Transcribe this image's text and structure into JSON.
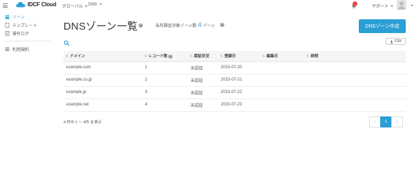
{
  "header": {
    "brand": "IDCF Cloud",
    "nav_global": "グローバル",
    "nav_dns": "DNS",
    "support": "サポート"
  },
  "sidebar": {
    "items": [
      {
        "label": "ゾーン",
        "icon": "zone-icon",
        "active": true
      },
      {
        "label": "テンプレート",
        "icon": "template-icon"
      },
      {
        "label": "操作ログ",
        "icon": "log-icon"
      },
      {
        "label": "利用規約",
        "icon": "terms-icon"
      }
    ]
  },
  "main": {
    "title": "DNSゾーン一覧",
    "zone_count_prefix": "当月課金対象ゾーン数",
    "zone_count_value": "4",
    "zone_count_suffix": "ゾーン",
    "create_button": "DNSゾーン作成",
    "csv_button": "CSV"
  },
  "table": {
    "headers": [
      "ドメイン",
      "レコード数",
      "認証状況",
      "登録日",
      "編集日",
      "説明"
    ],
    "rows": [
      {
        "domain": "example.com",
        "records": "1",
        "status": "未認証",
        "registered": "2015-07-20",
        "edited": "",
        "description": ""
      },
      {
        "domain": "example.co.jp",
        "records": "2",
        "status": "未認証",
        "registered": "2015-07-21",
        "edited": "",
        "description": ""
      },
      {
        "domain": "example.jp",
        "records": "3",
        "status": "未認証",
        "registered": "2015-07-22",
        "edited": "",
        "description": ""
      },
      {
        "domain": "example.net",
        "records": "4",
        "status": "未認証",
        "registered": "2015-07-23",
        "edited": "",
        "description": ""
      }
    ]
  },
  "pagination": {
    "info": "4 件中 1 ～ 4件 を表示",
    "prev": "‹",
    "current": "1",
    "next": "›"
  },
  "colors": {
    "accent": "#2a9fd6",
    "notification": "#e84c3d"
  }
}
